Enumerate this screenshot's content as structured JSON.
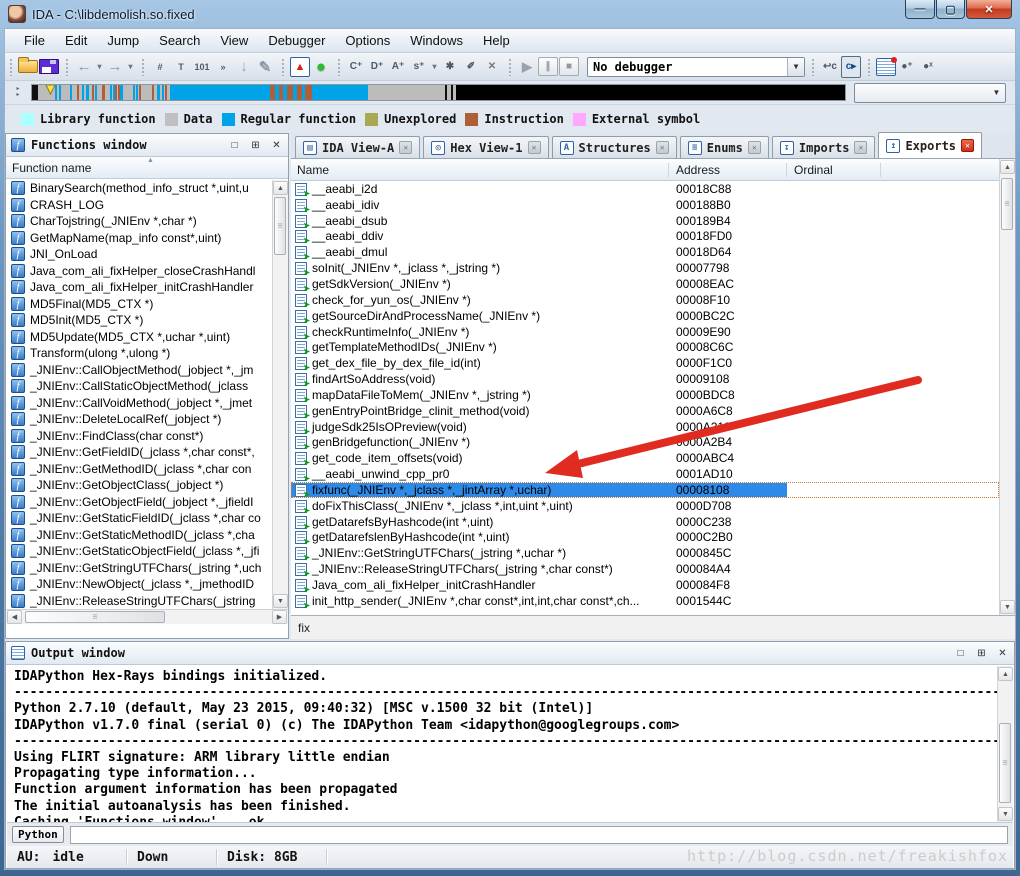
{
  "window": {
    "title": "IDA - C:\\libdemolish.so.fixed"
  },
  "menu": [
    "File",
    "Edit",
    "Jump",
    "Search",
    "View",
    "Debugger",
    "Options",
    "Windows",
    "Help"
  ],
  "toolbar": {
    "debugger_combo": "No debugger",
    "groups": [
      [
        {
          "name": "open-file",
          "cls": "ic-folder",
          "glyph": ""
        },
        {
          "name": "save-file",
          "cls": "ic-floppy",
          "glyph": ""
        }
      ],
      [
        {
          "name": "navigate-back",
          "cls": "ic-arrow",
          "glyph": "←"
        },
        {
          "name": "navigate-back-menu",
          "cls": "ic-dd",
          "glyph": "▾"
        },
        {
          "name": "navigate-forward",
          "cls": "ic-arrow",
          "glyph": "→"
        },
        {
          "name": "navigate-forward-menu",
          "cls": "ic-dd",
          "glyph": "▾"
        }
      ],
      [
        {
          "name": "search-immediate",
          "cls": "ic-bino",
          "glyph": "#"
        },
        {
          "name": "search-text",
          "cls": "ic-bino",
          "glyph": "T"
        },
        {
          "name": "search-binary",
          "cls": "ic-bino",
          "glyph": "101"
        },
        {
          "name": "search-next",
          "cls": "ic-bino",
          "glyph": "»"
        },
        {
          "name": "jump-to-address",
          "cls": "ic-arrow ic-blue",
          "glyph": "↓"
        },
        {
          "name": "lock-highlight",
          "cls": "ic-arrow",
          "glyph": "✎"
        }
      ],
      [
        {
          "name": "analysis-problems",
          "cls": "ic-warn",
          "glyph": "▲"
        },
        {
          "name": "analysis-indicator",
          "cls": "ic-ball",
          "glyph": "●"
        }
      ],
      [
        {
          "name": "make-code",
          "cls": "ic-mini",
          "glyph": "C⁺"
        },
        {
          "name": "make-data",
          "cls": "ic-mini",
          "glyph": "D⁺"
        },
        {
          "name": "make-name",
          "cls": "ic-mini",
          "glyph": "A⁺"
        },
        {
          "name": "make-string",
          "cls": "ic-mini",
          "glyph": "s⁺"
        },
        {
          "name": "make-string-menu",
          "cls": "ic-dd",
          "glyph": "▾"
        },
        {
          "name": "make-unknown",
          "cls": "ic-mini",
          "glyph": "✱"
        },
        {
          "name": "edit-function",
          "cls": "ic-mini",
          "glyph": "✐"
        },
        {
          "name": "delete-function",
          "cls": "ic-mini ic-xred",
          "glyph": "✕"
        }
      ],
      [
        {
          "name": "start-process",
          "cls": "ic-play",
          "glyph": "▶"
        },
        {
          "name": "pause-process",
          "cls": "ic-boxg",
          "glyph": "∥"
        },
        {
          "name": "stop-process",
          "cls": "ic-boxg",
          "glyph": "■"
        }
      ]
    ],
    "right_groups": [
      [
        {
          "name": "attach-to-process",
          "cls": "ic-mini",
          "glyph": "↩c"
        },
        {
          "name": "run-to-cursor",
          "cls": "ic-mini ic-active",
          "glyph": "c▸"
        }
      ],
      [
        {
          "name": "script-snippets",
          "cls": "ic-note",
          "glyph": ""
        },
        {
          "name": "add-breakpoint",
          "cls": "ic-mini",
          "glyph": "●⁺"
        },
        {
          "name": "delete-breakpoint",
          "cls": "ic-mini",
          "glyph": "●ˣ"
        }
      ]
    ]
  },
  "legend": [
    {
      "label": "Library function",
      "color": "#aaffff"
    },
    {
      "label": "Data",
      "color": "#c0c0c0"
    },
    {
      "label": "Regular function",
      "color": "#00a2e8"
    },
    {
      "label": "Unexplored",
      "color": "#a8a855"
    },
    {
      "label": "Instruction",
      "color": "#ad6038"
    },
    {
      "label": "External symbol",
      "color": "#ffa8ff"
    }
  ],
  "functions_window": {
    "title": "Functions window",
    "header": "Function name",
    "items": [
      "BinarySearch(method_info_struct *,uint,u",
      "CRASH_LOG",
      "CharTojstring(_JNIEnv *,char *)",
      "GetMapName(map_info const*,uint)",
      "JNI_OnLoad",
      "Java_com_ali_fixHelper_closeCrashHandl",
      "Java_com_ali_fixHelper_initCrashHandler",
      "MD5Final(MD5_CTX *)",
      "MD5Init(MD5_CTX *)",
      "MD5Update(MD5_CTX *,uchar *,uint)",
      "Transform(ulong *,ulong *)",
      "_JNIEnv::CallObjectMethod(_jobject *,_jm",
      "_JNIEnv::CallStaticObjectMethod(_jclass",
      "_JNIEnv::CallVoidMethod(_jobject *,_jmet",
      "_JNIEnv::DeleteLocalRef(_jobject *)",
      "_JNIEnv::FindClass(char const*)",
      "_JNIEnv::GetFieldID(_jclass *,char const*,",
      "_JNIEnv::GetMethodID(_jclass *,char con",
      "_JNIEnv::GetObjectClass(_jobject *)",
      "_JNIEnv::GetObjectField(_jobject *,_jfieldI",
      "_JNIEnv::GetStaticFieldID(_jclass *,char co",
      "_JNIEnv::GetStaticMethodID(_jclass *,cha",
      "_JNIEnv::GetStaticObjectField(_jclass *,_jfi",
      "_JNIEnv::GetStringUTFChars(_jstring *,uch",
      "_JNIEnv::NewObject(_jclass *,_jmethodID",
      "_JNIEnv::ReleaseStringUTFChars(_jstring"
    ]
  },
  "tabs": [
    {
      "label": "IDA View-A",
      "icon": "▤"
    },
    {
      "label": "Hex View-1",
      "icon": "◎"
    },
    {
      "label": "Structures",
      "icon": "A"
    },
    {
      "label": "Enums",
      "icon": "≡"
    },
    {
      "label": "Imports",
      "icon": "↧"
    },
    {
      "label": "Exports",
      "icon": "↥"
    }
  ],
  "tabs_active_index": 5,
  "exports": {
    "columns": [
      "Name",
      "Address",
      "Ordinal"
    ],
    "selected_index": 19,
    "status_text": "fix",
    "rows": [
      {
        "name": "__aeabi_i2d",
        "address": "00018C88"
      },
      {
        "name": "__aeabi_idiv",
        "address": "000188B0"
      },
      {
        "name": "__aeabi_dsub",
        "address": "000189B4"
      },
      {
        "name": "__aeabi_ddiv",
        "address": "00018FD0"
      },
      {
        "name": "__aeabi_dmul",
        "address": "00018D64"
      },
      {
        "name": "soInit(_JNIEnv *,_jclass *,_jstring *)",
        "address": "00007798"
      },
      {
        "name": "getSdkVersion(_JNIEnv *)",
        "address": "00008EAC"
      },
      {
        "name": "check_for_yun_os(_JNIEnv *)",
        "address": "00008F10"
      },
      {
        "name": "getSourceDirAndProcessName(_JNIEnv *)",
        "address": "0000BC2C"
      },
      {
        "name": "checkRuntimeInfo(_JNIEnv *)",
        "address": "00009E90"
      },
      {
        "name": "getTemplateMethodIDs(_JNIEnv *)",
        "address": "00008C6C"
      },
      {
        "name": "get_dex_file_by_dex_file_id(int)",
        "address": "0000F1C0"
      },
      {
        "name": "findArtSoAddress(void)",
        "address": "00009108"
      },
      {
        "name": "mapDataFileToMem(_JNIEnv *,_jstring *)",
        "address": "0000BDC8"
      },
      {
        "name": "genEntryPointBridge_clinit_method(void)",
        "address": "0000A6C8"
      },
      {
        "name": "judgeSdk25IsOPreview(void)",
        "address": "0000A210"
      },
      {
        "name": "genBridgefunction(_JNIEnv *)",
        "address": "0000A2B4"
      },
      {
        "name": "get_code_item_offsets(void)",
        "address": "0000ABC4"
      },
      {
        "name": "__aeabi_unwind_cpp_pr0",
        "address": "0001AD10"
      },
      {
        "name": "fixfunc(_JNIEnv *,_jclass *,_jintArray *,uchar)",
        "address": "00008108"
      },
      {
        "name": "doFixThisClass(_JNIEnv *,_jclass *,int,uint *,uint)",
        "address": "0000D708"
      },
      {
        "name": "getDatarefsByHashcode(int *,uint)",
        "address": "0000C238"
      },
      {
        "name": "getDatarefslenByHashcode(int *,uint)",
        "address": "0000C2B0"
      },
      {
        "name": "_JNIEnv::GetStringUTFChars(_jstring *,uchar *)",
        "address": "0000845C"
      },
      {
        "name": "_JNIEnv::ReleaseStringUTFChars(_jstring *,char const*)",
        "address": "000084A4"
      },
      {
        "name": "Java_com_ali_fixHelper_initCrashHandler",
        "address": "000084F8"
      },
      {
        "name": "init_http_sender(_JNIEnv *,char const*,int,int,char const*,ch...",
        "address": "0001544C"
      }
    ]
  },
  "output_window": {
    "title": "Output window",
    "lines": [
      "IDAPython Hex-Rays bindings initialized.",
      "------------------------------------------------------------------------------------------------------------------------------",
      "Python 2.7.10 (default, May 23 2015, 09:40:32) [MSC v.1500 32 bit (Intel)]",
      "IDAPython v1.7.0 final (serial 0) (c) The IDAPython Team <idapython@googlegroups.com>",
      "------------------------------------------------------------------------------------------------------------------------------",
      "Using FLIRT signature: ARM library little endian",
      "Propagating type information...",
      "Function argument information has been propagated",
      "The initial autoanalysis has been finished.",
      "Caching 'Functions window'... ok"
    ],
    "prompt_button": "Python",
    "input_value": ""
  },
  "statusbar": {
    "au_label": "AU:",
    "au_value": "idle",
    "network": "Down",
    "disk": "Disk: 8GB",
    "watermark": "http://blog.csdn.net/freakishfox"
  }
}
